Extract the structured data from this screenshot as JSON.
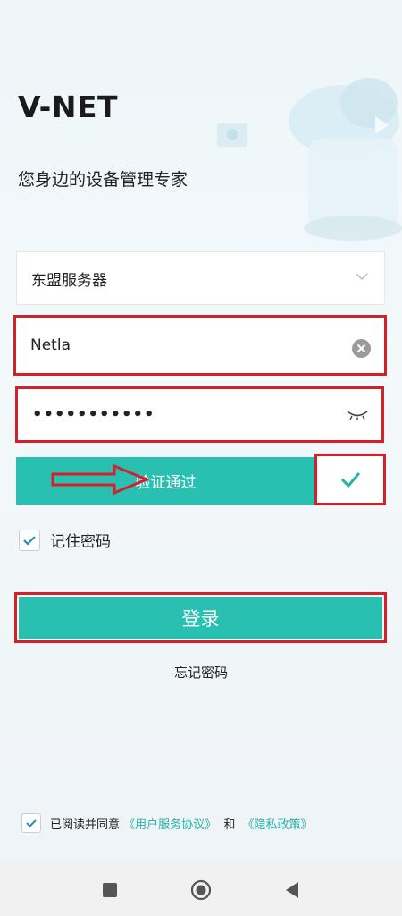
{
  "app_title": "V-NET",
  "subtitle": "您身边的设备管理专家",
  "server_select": {
    "value": "东盟服务器"
  },
  "username": {
    "value": "Netla"
  },
  "password": {
    "value": "•••••••••••"
  },
  "verify": {
    "label": "验证通过"
  },
  "remember": {
    "label": "记住密码",
    "checked": true
  },
  "login": {
    "label": "登录"
  },
  "forgot": {
    "label": "忘记密码"
  },
  "agreement": {
    "prefix": "已阅读并同意",
    "user_agreement": "《用户服务协议》",
    "and": "和",
    "privacy": "《隐私政策》",
    "checked": true
  },
  "colors": {
    "accent": "#29c0b1",
    "highlight": "#d4202b",
    "link": "#29b3a6",
    "check": "#1f8fc1"
  },
  "icons": {
    "server_chevron": "chevron-down-icon",
    "clear": "clear-icon",
    "eye": "eye-closed-icon",
    "verify_check": "checkmark-icon",
    "nav_recent": "square-icon",
    "nav_home": "circle-icon",
    "nav_back": "triangle-back-icon"
  }
}
